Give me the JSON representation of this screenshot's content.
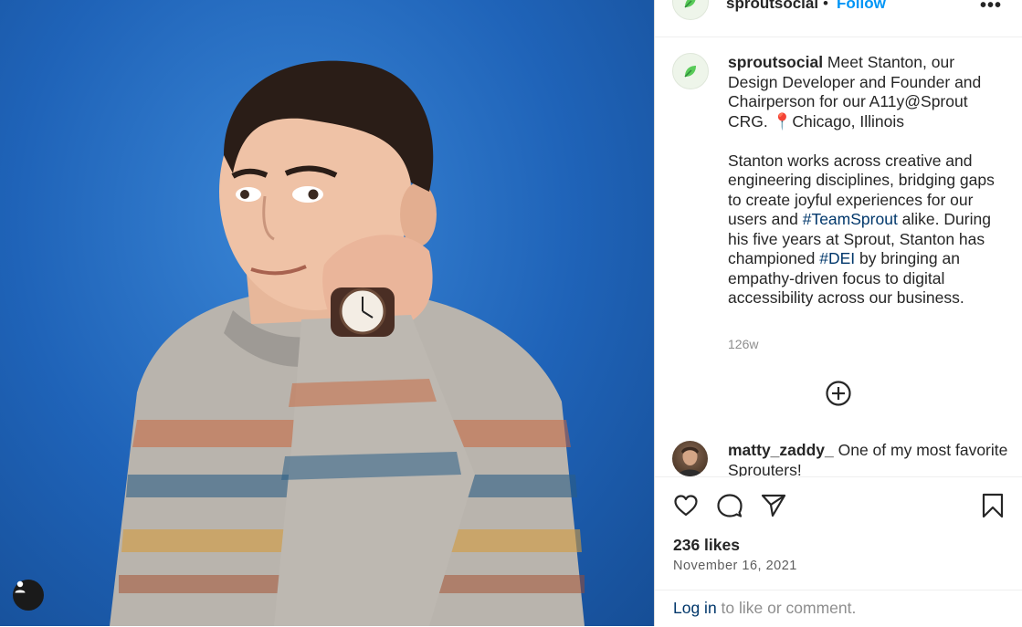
{
  "post": {
    "username": "sproutsocial",
    "follow_label": "Follow",
    "separator": "•",
    "more_label": "•••"
  },
  "caption": {
    "username": "sproutsocial",
    "line1_text": " Meet Stanton, our Design Developer and Founder and Chairperson for our A11y@Sprout CRG. ",
    "pin_emoji": "📍",
    "location": "Chicago, Illinois",
    "p2_part1": "Stanton works across creative and engineering disciplines, bridging gaps to create joyful experiences for our users and ",
    "hashtag1": "#TeamSprout",
    "p2_part2": " alike. During his five years at Sprout, Stanton has championed ",
    "hashtag2": "#DEI",
    "p2_part3": " by bringing an empathy-driven focus to digital accessibility across our business.",
    "time_ago": "126w"
  },
  "comment": {
    "username": "matty_zaddy_",
    "text": " One of my most favorite Sprouters!"
  },
  "stats": {
    "likes": "236 likes",
    "date": "November 16, 2021"
  },
  "login": {
    "link_label": "Log in",
    "rest_text": " to like or comment."
  },
  "icons": {
    "like": "heart-icon",
    "comment": "comment-icon",
    "share": "paper-plane-icon",
    "save": "bookmark-icon",
    "load_more": "plus-circle-icon",
    "tagged_users": "user-icon"
  },
  "colors": {
    "link_blue": "#0095f6",
    "hashtag": "#00376b",
    "brand_green": "#59cb59",
    "photo_background": "#1f63b8"
  }
}
